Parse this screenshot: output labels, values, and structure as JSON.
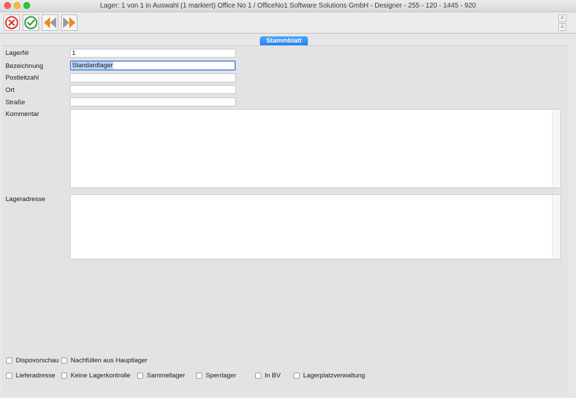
{
  "window": {
    "title": "Lager: 1 von 1 in Auswahl  (1 markiert) Office No 1 /  OfficeNo1 Software Solutions GmbH - Designer - 255 - 120 - 1445 - 920"
  },
  "toolbar": {
    "buttons": [
      {
        "name": "cancel-button",
        "icon": "cancel-x-icon"
      },
      {
        "name": "confirm-button",
        "icon": "checkmark-icon"
      },
      {
        "name": "previous-button",
        "icon": "arrow-left-icon"
      },
      {
        "name": "next-button",
        "icon": "arrow-right-icon"
      }
    ],
    "zoom_in_label": "A",
    "zoom_out_label": "A"
  },
  "tabs": {
    "active": "Stammblatt"
  },
  "form": {
    "lagernr": {
      "label": "LagerNr",
      "value": "1"
    },
    "bezeichnung": {
      "label": "Bezeichnung",
      "value": "Standardlager"
    },
    "postleitzahl": {
      "label": "Postleitzahl",
      "value": ""
    },
    "ort": {
      "label": "Ort",
      "value": ""
    },
    "strasse": {
      "label": "Straße",
      "value": ""
    },
    "kommentar": {
      "label": "Kommentar",
      "value": ""
    },
    "lageradresse": {
      "label": "Lageradresse",
      "value": ""
    }
  },
  "checkboxes": {
    "dispovorschau": {
      "label": "Dispovorschau",
      "checked": false
    },
    "nachfuellen": {
      "label": "Nachfüllen aus Hauptlager",
      "checked": false
    },
    "lieferadresse": {
      "label": "Lieferadresse",
      "checked": false
    },
    "keine_lagerkontrolle": {
      "label": "Keine Lagerkontrolle",
      "checked": false
    },
    "sammellager": {
      "label": "Sammellager",
      "checked": false
    },
    "sperrlager": {
      "label": "Sperrlager",
      "checked": false
    },
    "in_bv": {
      "label": "In BV",
      "checked": false
    },
    "lagerplatzverwaltung": {
      "label": "Lagerplatzverwaltung",
      "checked": false
    }
  },
  "colors": {
    "tab_accent": "#1f7ff0",
    "cancel_red": "#d9342b",
    "confirm_green": "#2e9a3c",
    "nav_orange": "#f08a1c"
  }
}
